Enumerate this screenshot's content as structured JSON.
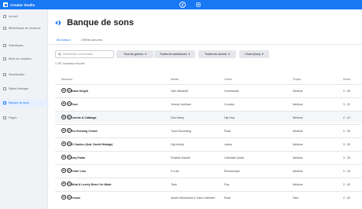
{
  "app": {
    "name": "Creator Studio",
    "accent": "#1877f2"
  },
  "topbar": {
    "icons": [
      "facebook-icon",
      "instagram-icon"
    ]
  },
  "sidebar": {
    "items": [
      {
        "label": "Accueil",
        "icon": "home-icon",
        "active": false
      },
      {
        "label": "Bibliothèque de contenus",
        "icon": "library-icon",
        "active": false
      },
      {
        "label": "Statistiques",
        "icon": "chart-icon",
        "active": false
      },
      {
        "label": "Boîte de réception",
        "icon": "inbox-icon",
        "active": false
      },
      {
        "label": "Monétisation",
        "icon": "money-icon",
        "active": false
      },
      {
        "label": "Rights Manager",
        "icon": "rights-icon",
        "active": false
      },
      {
        "label": "Banque de sons",
        "icon": "sound-icon",
        "active": true
      },
      {
        "label": "Pages",
        "icon": "pages-icon",
        "active": false
      }
    ]
  },
  "page": {
    "title": "Banque de sons",
    "icon": "sound-icon"
  },
  "tabs": [
    {
      "label": "Morceaux",
      "active": true
    },
    {
      "label": "Effets sonores",
      "active": false
    }
  ],
  "search": {
    "placeholder": "Recherchez un morceau"
  },
  "filters": [
    {
      "label": "Tous les genres"
    },
    {
      "label": "Toutes les ambiances"
    },
    {
      "label": "Toutes les durées"
    },
    {
      "label": "Chant (tous)"
    }
  ],
  "result_count": "1 307 morceaux trouvés",
  "table": {
    "columns": [
      "Morceau",
      "Artiste",
      "Genre",
      "Tempo",
      "Durée"
    ],
    "rows": [
      {
        "title": "Black Knight",
        "artist": "Sam Marshall",
        "genre": "Orchestrale",
        "tempo": "Medium",
        "duration": "2 : 49"
      },
      {
        "title": "Floor",
        "artist": "Jimmy Houlihan",
        "genre": "Country",
        "tempo": "Medium",
        "duration": "3 : 21"
      },
      {
        "title": "Carrots & Cabbage",
        "artist": "Dan Warry",
        "genre": "Hip Hop",
        "tempo": "Medium",
        "duration": "2 : 41"
      },
      {
        "title": "The Evening Crowd",
        "artist": "Trout Recording",
        "genre": "Rock",
        "tempo": "Medium",
        "duration": "2 : 26"
      },
      {
        "title": "El Camino (feat. David Hidalgo)",
        "artist": "Dig Infinity",
        "genre": "Latino",
        "tempo": "Medium",
        "duration": "3 : 30"
      },
      {
        "title": "Ishq Fatira",
        "artist": "Prateek Gandhi",
        "genre": "Orientale (Inde)",
        "tempo": "Medium",
        "duration": "3 : 25"
      },
      {
        "title": "Feelin' Like",
        "artist": "K+Lab",
        "genre": "Électronique",
        "tempo": "Medium",
        "duration": "2 : 18"
      },
      {
        "title": "What A Lovely Mess I've Made",
        "artist": "Tank",
        "genre": "Pop",
        "tempo": "Medium",
        "duration": "2 : 40"
      },
      {
        "title": "Pursue",
        "artist": "Austin Woodward & Zack Ledbetter",
        "genre": "Rock",
        "tempo": "Fast",
        "duration": "2 : 43"
      }
    ]
  }
}
